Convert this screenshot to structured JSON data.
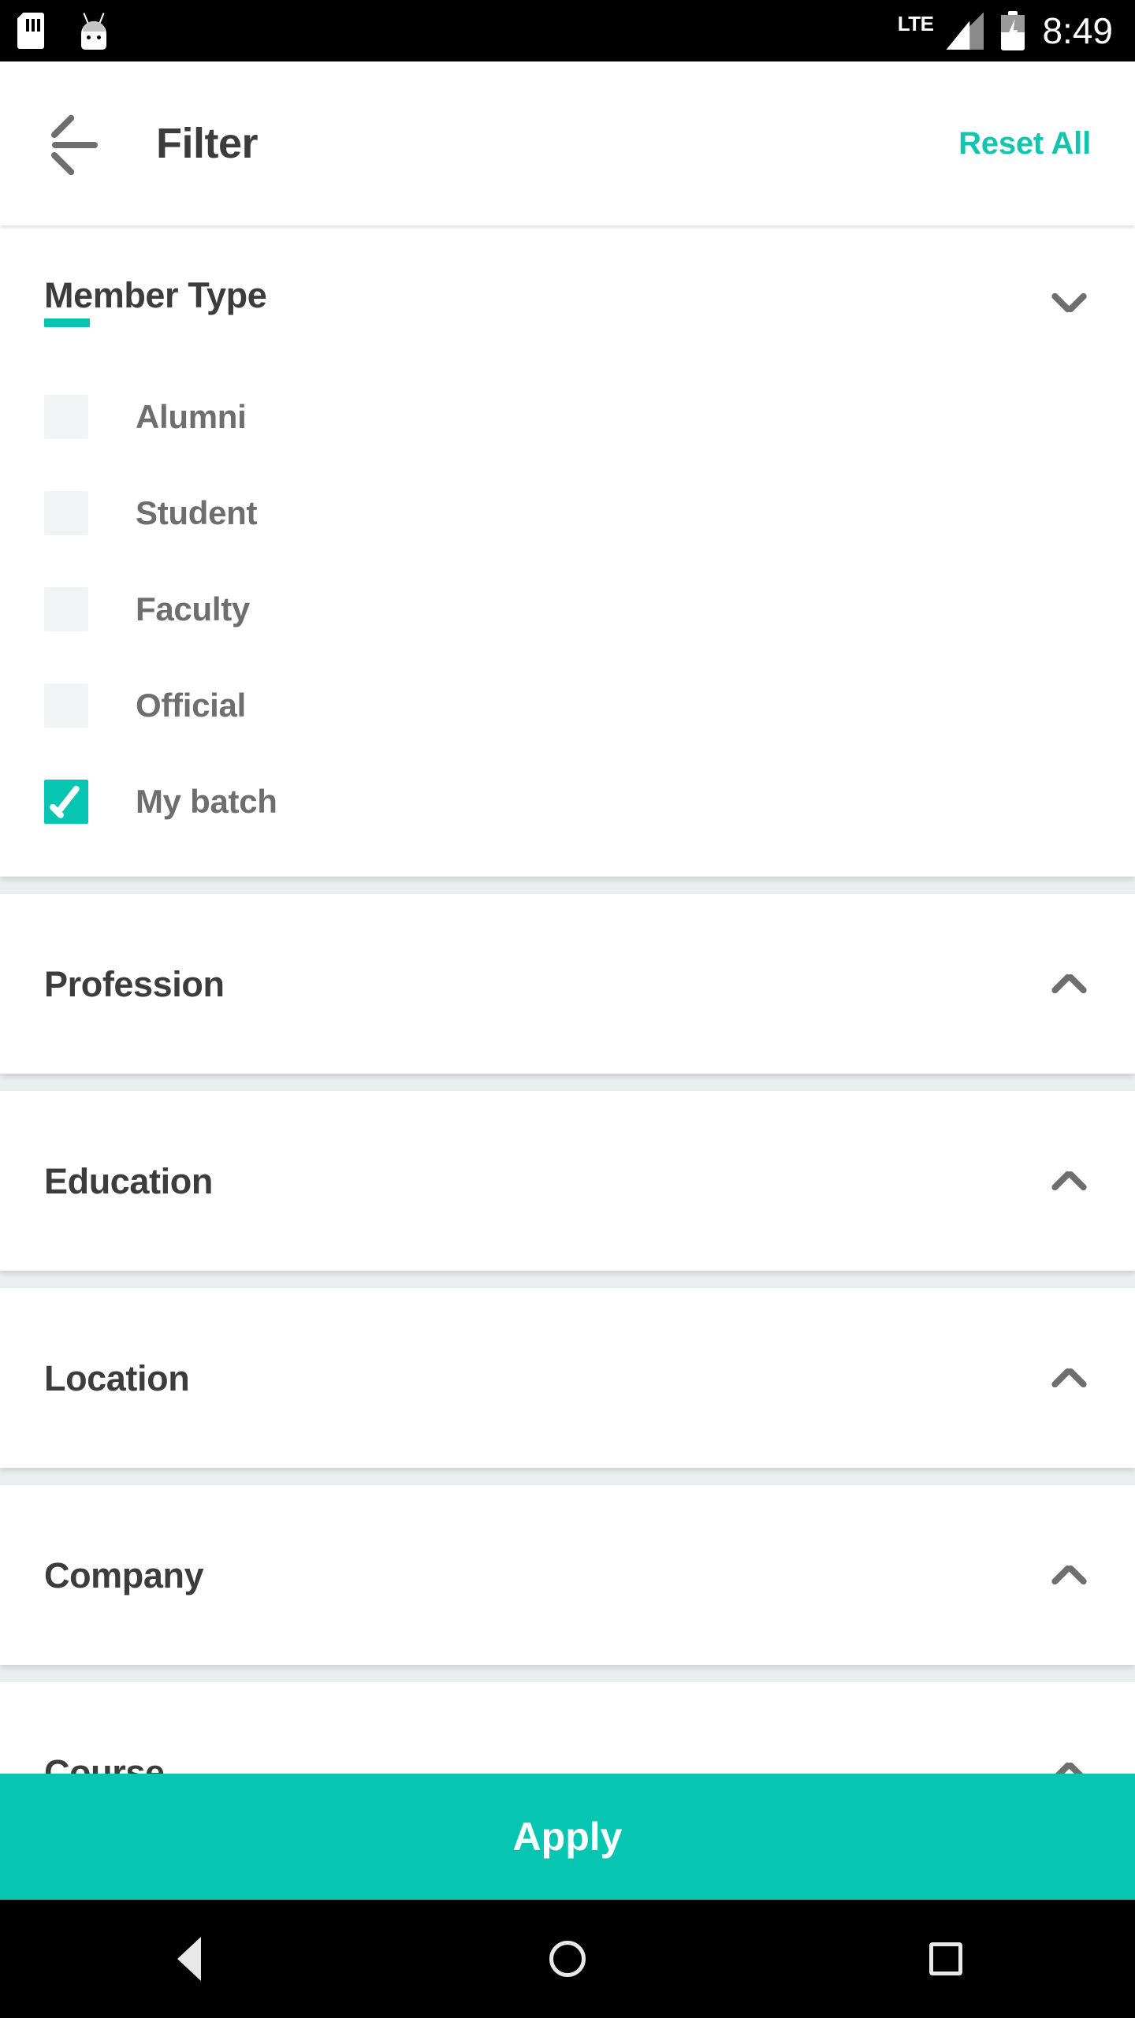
{
  "status_bar": {
    "icons_left": [
      "sim-card-icon",
      "android-robot-icon"
    ],
    "network_label": "LTE",
    "signal_icon": "signal-bars-icon",
    "battery_icon": "battery-charging-icon",
    "time": "8:49"
  },
  "app_bar": {
    "back_icon": "arrow-left-icon",
    "title": "Filter",
    "reset_label": "Reset All",
    "accent_color": "#13c4ae"
  },
  "sections": [
    {
      "title": "Member Type",
      "expanded": true,
      "chevron": "chevron-down-icon",
      "options": [
        {
          "label": "Alumni",
          "checked": false
        },
        {
          "label": "Student",
          "checked": false
        },
        {
          "label": "Faculty",
          "checked": false
        },
        {
          "label": "Official",
          "checked": false
        },
        {
          "label": "My batch",
          "checked": true
        }
      ]
    },
    {
      "title": "Profession",
      "expanded": false,
      "chevron": "chevron-up-icon",
      "options": []
    },
    {
      "title": "Education",
      "expanded": false,
      "chevron": "chevron-up-icon",
      "options": []
    },
    {
      "title": "Location",
      "expanded": false,
      "chevron": "chevron-up-icon",
      "options": []
    },
    {
      "title": "Company",
      "expanded": false,
      "chevron": "chevron-up-icon",
      "options": []
    },
    {
      "title": "Course",
      "expanded": false,
      "chevron": "chevron-up-icon",
      "options": []
    }
  ],
  "apply_button": {
    "label": "Apply",
    "color": "#06c6b2"
  },
  "nav_bar": {
    "back": "nav-back-triangle-icon",
    "home": "nav-home-circle-icon",
    "recents": "nav-recents-square-icon"
  },
  "colors": {
    "accent_teal": "#06c6b2",
    "reset_teal": "#13c4ae",
    "title_gray": "#3c3c3c",
    "label_gray": "#6e6e6e",
    "page_bg": "#eceff0",
    "checkbox_empty": "#f1f3f4"
  }
}
